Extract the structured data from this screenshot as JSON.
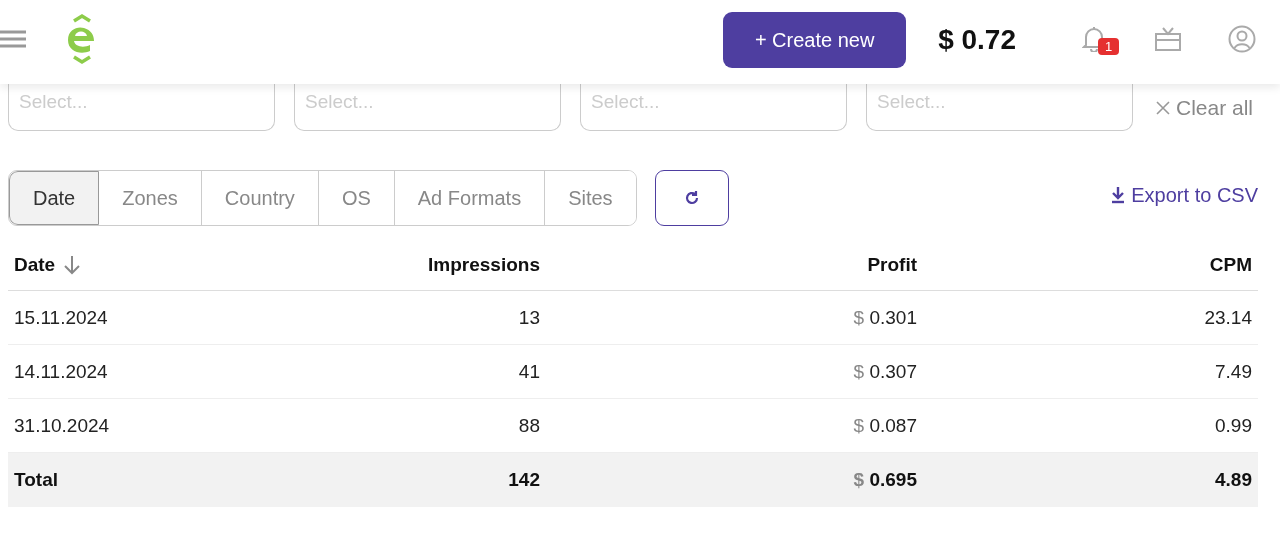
{
  "header": {
    "create_button": "+ Create new",
    "balance": "$ 0.72",
    "notification_count": "1"
  },
  "filters": [
    {
      "placeholder": "Select..."
    },
    {
      "placeholder": "Select..."
    },
    {
      "placeholder": "Select..."
    },
    {
      "placeholder": "Select..."
    }
  ],
  "clear_all": "Clear all",
  "tabs": [
    {
      "label": "Date",
      "selected": true
    },
    {
      "label": "Zones",
      "selected": false
    },
    {
      "label": "Country",
      "selected": false
    },
    {
      "label": "OS",
      "selected": false
    },
    {
      "label": "Ad Formats",
      "selected": false
    },
    {
      "label": "Sites",
      "selected": false
    }
  ],
  "export": "Export to CSV",
  "table": {
    "columns": [
      {
        "label": "Date",
        "sorted": true
      },
      {
        "label": "Impressions",
        "sorted": false
      },
      {
        "label": "Profit",
        "sorted": false
      },
      {
        "label": "CPM",
        "sorted": false
      }
    ],
    "rows": [
      {
        "date": "15.11.2024",
        "impressions": "13",
        "currency": "$",
        "profit": "0.301",
        "cpm": "23.14"
      },
      {
        "date": "14.11.2024",
        "impressions": "41",
        "currency": "$",
        "profit": "0.307",
        "cpm": "7.49"
      },
      {
        "date": "31.10.2024",
        "impressions": "88",
        "currency": "$",
        "profit": "0.087",
        "cpm": "0.99"
      }
    ],
    "total": {
      "label": "Total",
      "impressions": "142",
      "currency": "$",
      "profit": "0.695",
      "cpm": "4.89"
    }
  }
}
